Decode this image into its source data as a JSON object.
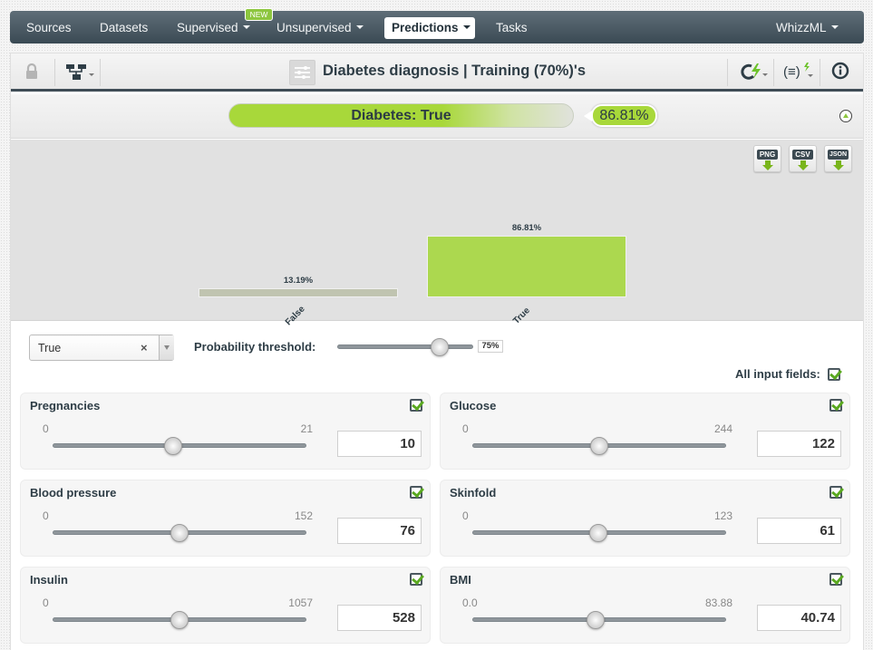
{
  "nav": {
    "items": [
      {
        "label": "Sources",
        "dropdown": false
      },
      {
        "label": "Datasets",
        "dropdown": false
      },
      {
        "label": "Supervised",
        "dropdown": true,
        "badge": "NEW"
      },
      {
        "label": "Unsupervised",
        "dropdown": true
      },
      {
        "label": "Predictions",
        "dropdown": true,
        "active": true
      },
      {
        "label": "Tasks",
        "dropdown": false
      }
    ],
    "right_item": {
      "label": "WhizzML",
      "dropdown": true
    }
  },
  "toolbar": {
    "title": "Diabetes diagnosis | Training (70%)'s",
    "icons": [
      "lock-icon",
      "tree-model-icon",
      "model-form-icon",
      "batch-prediction-icon",
      "formula-icon",
      "info-icon"
    ]
  },
  "prediction": {
    "label": "Diabetes: True",
    "confidence": "86.81%",
    "confidence_value": 0.8681
  },
  "export_buttons": [
    "PNG",
    "CSV",
    "JSON"
  ],
  "chart_data": {
    "type": "bar",
    "categories": [
      "False",
      "True"
    ],
    "values": [
      13.19,
      86.81
    ],
    "value_labels": [
      "13.19%",
      "86.81%"
    ],
    "colors": [
      "#c0c4b0",
      "#acd84f"
    ],
    "title": "",
    "xlabel": "",
    "ylabel": "",
    "ylim": [
      0,
      100
    ]
  },
  "controls": {
    "class_select": {
      "value": "True"
    },
    "threshold_label": "Probability threshold:",
    "threshold_value": "75%",
    "threshold_fraction": 0.75,
    "all_fields_label": "All input fields:",
    "all_fields_checked": true
  },
  "fields": [
    {
      "name": "Pregnancies",
      "min": "0",
      "max": "21",
      "value": "10",
      "fraction": 0.476,
      "checked": true
    },
    {
      "name": "Glucose",
      "min": "0",
      "max": "244",
      "value": "122",
      "fraction": 0.5,
      "checked": true
    },
    {
      "name": "Blood pressure",
      "min": "0",
      "max": "152",
      "value": "76",
      "fraction": 0.5,
      "checked": true
    },
    {
      "name": "Skinfold",
      "min": "0",
      "max": "123",
      "value": "61",
      "fraction": 0.496,
      "checked": true
    },
    {
      "name": "Insulin",
      "min": "0",
      "max": "1057",
      "value": "528",
      "fraction": 0.5,
      "checked": true
    },
    {
      "name": "BMI",
      "min": "0.0",
      "max": "83.88",
      "value": "40.74",
      "fraction": 0.486,
      "checked": true
    }
  ]
}
